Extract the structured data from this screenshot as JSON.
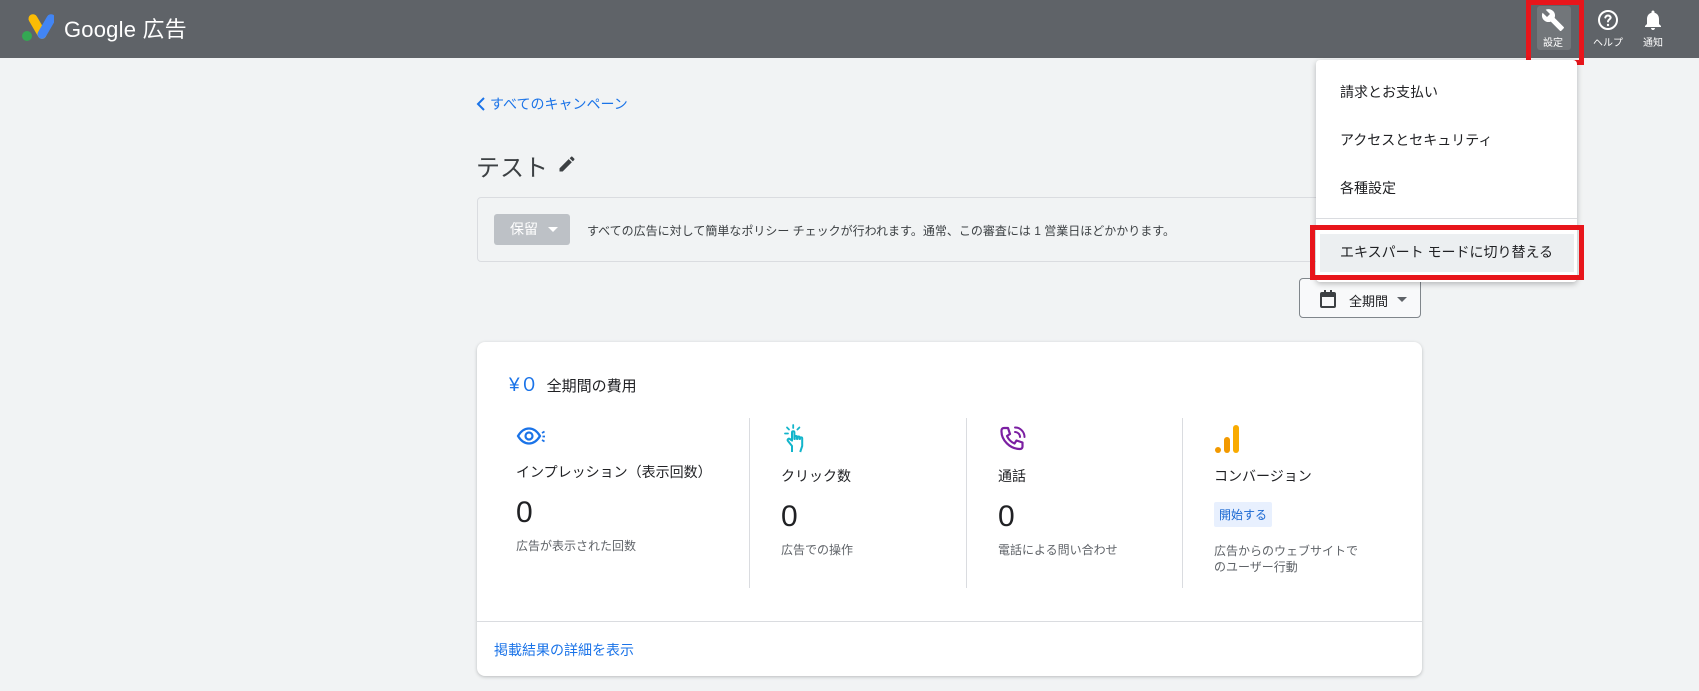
{
  "header": {
    "brand": "Google 広告",
    "settings_label": "設定",
    "help_label": "ヘルプ",
    "notify_label": "通知"
  },
  "icons": {
    "logo": "google-ads-logo",
    "settings": "wrench-icon",
    "help": "help-circle-icon",
    "notify": "bell-icon",
    "back": "chevron-left-icon",
    "edit": "pencil-icon",
    "calendar": "calendar-icon",
    "impressions": "eye-icon",
    "clicks": "tap-icon",
    "calls": "phone-call-icon",
    "conversions": "bar-chart-icon"
  },
  "settings_menu": {
    "items": [
      "請求とお支払い",
      "アクセスとセキュリティ",
      "各種設定",
      "エキスパート モードに切り替える"
    ]
  },
  "campaign": {
    "back_link": "すべてのキャンペーン",
    "title": "テスト",
    "status": "保留",
    "notice": "すべての広告に対して簡単なポリシー チェックが行われます。通常、この審査には 1 営業日ほどかかります。",
    "date_range": "全期間"
  },
  "summary": {
    "cost_amount": "¥０",
    "cost_label": "全期間の費用",
    "metrics": [
      {
        "label": "インプレッション（表示回数）",
        "value": "0",
        "desc": "広告が表示された回数"
      },
      {
        "label": "クリック数",
        "value": "0",
        "desc": "広告での操作"
      },
      {
        "label": "通話",
        "value": "0",
        "desc": "電話による問い合わせ"
      },
      {
        "label": "コンバージョン",
        "action": "開始する",
        "desc": "広告からのウェブサイトでのユーザー行動"
      }
    ],
    "details_link": "掲載結果の詳細を表示"
  },
  "colors": {
    "topbar": "#5f6368",
    "link_blue": "#1a73e8",
    "highlight_red": "#e8151b",
    "logo_blue": "#4285f4",
    "logo_yellow": "#fbbc04",
    "logo_green": "#34a853",
    "conversion_orange": "#f29900",
    "calls_purple": "#7b1fa2",
    "clicks_cyan": "#12b5cb"
  }
}
